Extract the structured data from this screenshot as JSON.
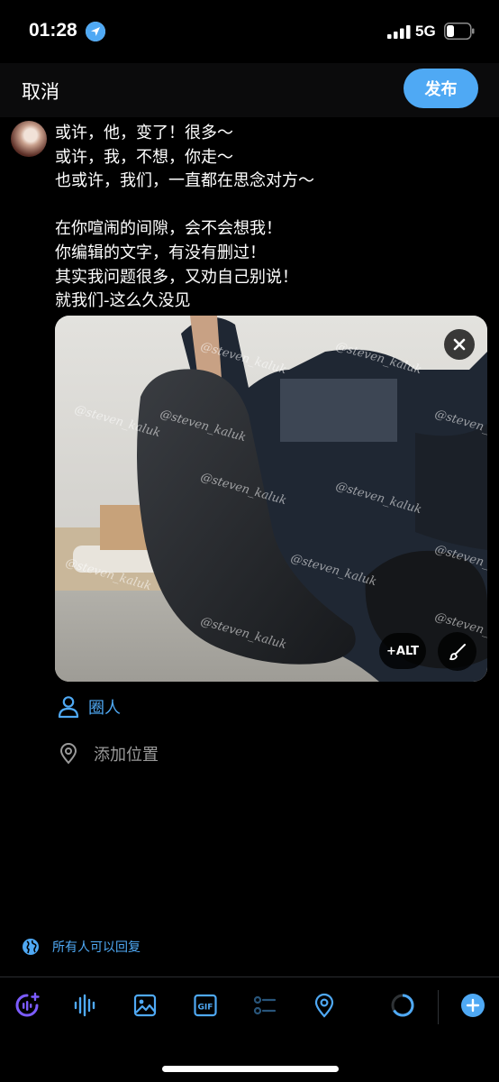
{
  "status_bar": {
    "time": "01:28",
    "network": "5G"
  },
  "header": {
    "cancel_label": "取消",
    "publish_label": "发布"
  },
  "post": {
    "text": "或许，他，变了！很多～\n或许，我，不想，你走～\n也或许，我们，一直都在思念对方～\n\n在你喧闹的间隙，会不会想我！\n你编辑的文字，有没有删过！\n其实我问题很多，又劝自己别说！\n就我们-这么久没见"
  },
  "media": {
    "alt_label": "+ALT",
    "watermark": "@steven_kaluk"
  },
  "actions": {
    "tag_people_label": "圈人",
    "add_location_label": "添加位置"
  },
  "reply_setting": {
    "label": "所有人可以回复"
  },
  "toolbar": {
    "icons": [
      "grok-sparkle-icon",
      "audio-waveform-icon",
      "image-icon",
      "gif-icon",
      "poll-icon",
      "location-pin-icon",
      "char-progress-icon",
      "add-post-icon"
    ]
  },
  "colors": {
    "accent": "#4fa9f4",
    "background": "#000000",
    "header_bg": "#0b0b0c",
    "muted": "#9a9a9a",
    "grok_purple": "#7c5cff"
  }
}
